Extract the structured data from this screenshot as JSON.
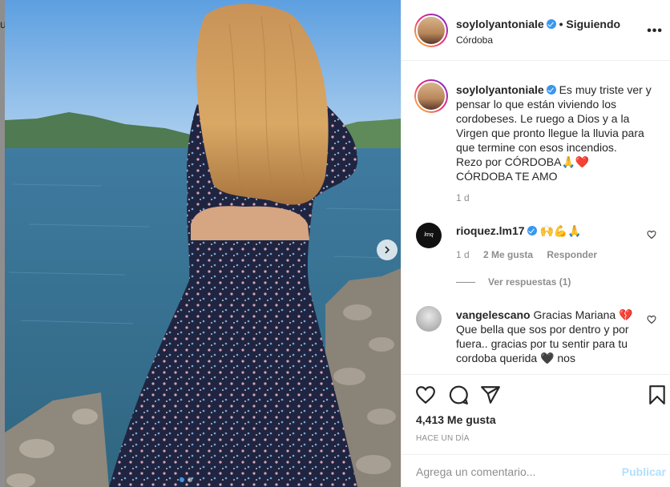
{
  "left_edge_char": "u",
  "header": {
    "username": "soylolyantoniale",
    "follow_status": "• Siguiendo",
    "location": "Córdoba",
    "more": "•••"
  },
  "caption": {
    "username": "soylolyantoniale",
    "text": "Es muy triste ver y pensar lo que están viviendo los cordobeses. Le ruego a Dios y a la Virgen que pronto llegue la lluvia para que termine con esos incendios.",
    "line2": "Rezo por CÓRDOBA🙏❤️",
    "line3": "CÓRDOBA TE AMO",
    "time": "1 d"
  },
  "comments": [
    {
      "username": "rioquez.lm17",
      "text": "🙌💪🙏",
      "avatar_text": "lmq",
      "time": "1 d",
      "likes": "2 Me gusta",
      "reply": "Responder",
      "view_replies": "Ver respuestas (1)"
    },
    {
      "username": "vangelescano",
      "text": "Gracias Mariana 💔 Que bella que sos por dentro y por fuera.. gracias por tu sentir para tu cordoba querida 🖤 nos"
    }
  ],
  "likes": "4,413 Me gusta",
  "posted": "HACE UN DÍA",
  "comment_input": {
    "placeholder": "Agrega un comentario...",
    "value": ""
  },
  "publish_label": "Publicar",
  "icons": [
    "heart-icon",
    "comment-icon",
    "share-icon",
    "bookmark-icon",
    "chevron-right-icon",
    "more-icon"
  ],
  "colors": {
    "accent": "#3897f0",
    "publish_disabled": "#b2dffc",
    "muted": "#8e8e8e"
  }
}
